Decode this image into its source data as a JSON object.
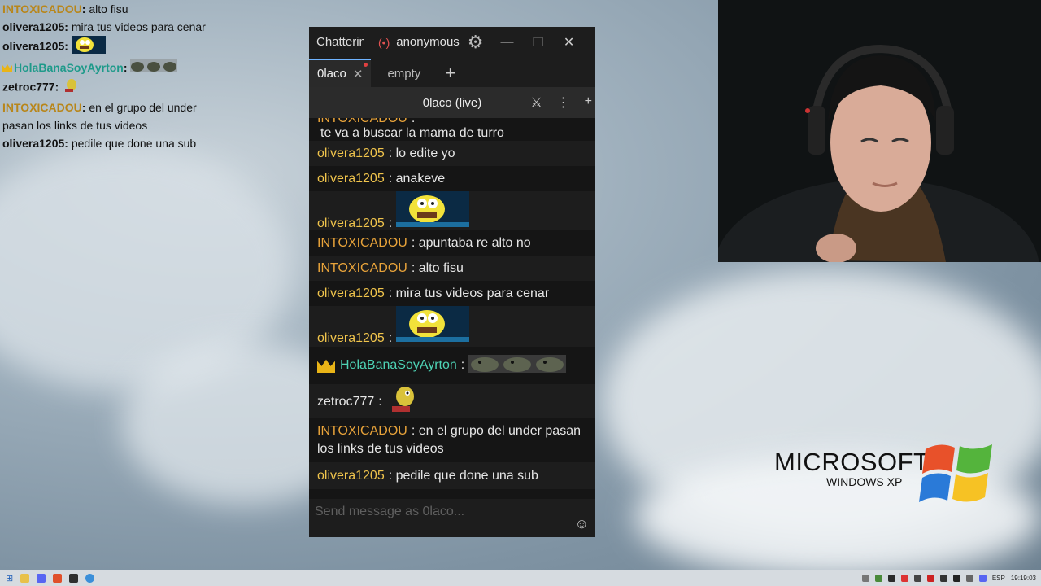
{
  "overlay_chat": [
    {
      "user": "INTOXICADOU",
      "user_color": "gold",
      "text": "alto fisu"
    },
    {
      "user": "olivera1205",
      "user_color": "dark",
      "text": "mira tus videos para cenar"
    },
    {
      "user": "olivera1205",
      "user_color": "dark",
      "text": "",
      "emote": "spongebob-emote"
    },
    {
      "user": "HolaBanaSoyAyrton",
      "user_color": "teal",
      "text": "",
      "badge": "crown",
      "emote": "frogs-emote"
    },
    {
      "user": "zetroc777",
      "user_color": "dark",
      "text": "",
      "emote": "fish-emote"
    },
    {
      "user": "INTOXICADOU",
      "user_color": "gold",
      "text": "en el grupo del under pasan los links de tus videos"
    },
    {
      "user": "olivera1205",
      "user_color": "dark",
      "text": "pedile que done una sub"
    }
  ],
  "window": {
    "app_title": "Chatterino",
    "live_indicator": "(•)",
    "account": "anonymous",
    "tabs": [
      {
        "label": "0laco",
        "active": true
      },
      {
        "label": "empty",
        "active": false
      }
    ],
    "split_title": "0laco (live)",
    "input_placeholder": "Send message as 0laco..."
  },
  "messages": [
    {
      "user": "INTOXICADOU",
      "color": "orange",
      "text": "te va a buscar la mama de turro",
      "partial": true
    },
    {
      "user": "olivera1205",
      "color": "yellow",
      "text": "lo edite yo"
    },
    {
      "user": "olivera1205",
      "color": "yellow",
      "text": "anakeve"
    },
    {
      "user": "olivera1205",
      "color": "yellow",
      "text": "",
      "emote": "spongebob-emote"
    },
    {
      "user": "INTOXICADOU",
      "color": "orange",
      "text": "apuntaba re alto no"
    },
    {
      "user": "INTOXICADOU",
      "color": "orange",
      "text": "alto fisu"
    },
    {
      "user": "olivera1205",
      "color": "yellow",
      "text": "mira tus videos para cenar"
    },
    {
      "user": "olivera1205",
      "color": "yellow",
      "text": "",
      "emote": "spongebob-emote"
    },
    {
      "user": "HolaBanaSoyAyrton",
      "color": "teal",
      "text": "",
      "badge": "crown",
      "emote": "frogs-emote"
    },
    {
      "user": "zetroc777",
      "color": "white",
      "text": "",
      "emote": "fish-emote"
    },
    {
      "user": "INTOXICADOU",
      "color": "orange",
      "text": "en el grupo del under pasan los links de tus videos"
    },
    {
      "user": "olivera1205",
      "color": "yellow",
      "text": "pedile que done una sub"
    }
  ],
  "desktop": {
    "brand": "MICROSOFT",
    "product": "WINDOWS XP"
  },
  "taskbar": {
    "language": "ESP",
    "clock": "19:19:03"
  },
  "colors": {
    "accent": "#6fb3ff",
    "name_yellow": "#f0c44c",
    "name_orange": "#e8a33a",
    "name_teal": "#4ed3b5",
    "live_red": "#e25252"
  }
}
